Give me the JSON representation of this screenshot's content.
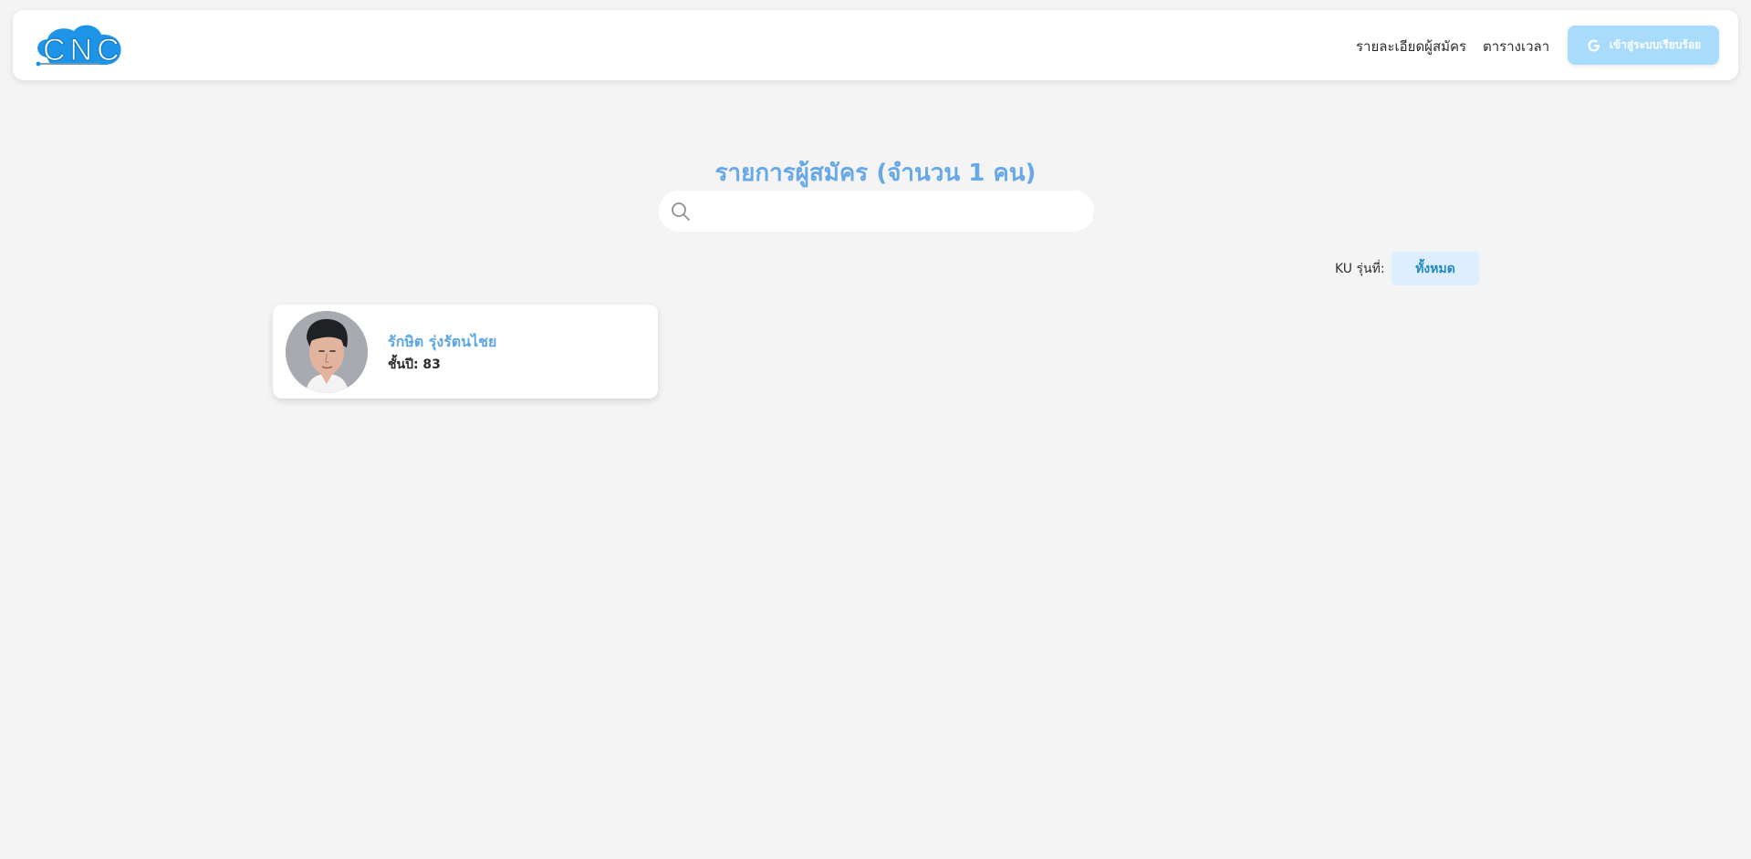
{
  "header": {
    "logo_text": "CNC",
    "nav": {
      "details": "รายละเอียดผู้สมัคร",
      "schedule": "ตารางเวลา"
    },
    "login_button": {
      "label": "เข้าสู่ระบบเรียบร้อย",
      "icon": "google-icon"
    }
  },
  "main": {
    "title": "รายการผู้สมัคร (จำนวน 1 คน)",
    "search": {
      "placeholder": "",
      "value": "",
      "icon": "search-icon"
    },
    "filter": {
      "label": "KU รุ่นที่:",
      "selected": "ทั้งหมด"
    },
    "applicants": [
      {
        "name": "รักษิต รุ่งรัตนไชย",
        "year": "ชั้นปี: 83",
        "avatar": "avatar-photo"
      }
    ]
  },
  "colors": {
    "background": "#f4f4f4",
    "title": "#67a9e8",
    "button": "#a9dcfc",
    "filter_bg": "#dceeff",
    "filter_text": "#2289c9"
  }
}
